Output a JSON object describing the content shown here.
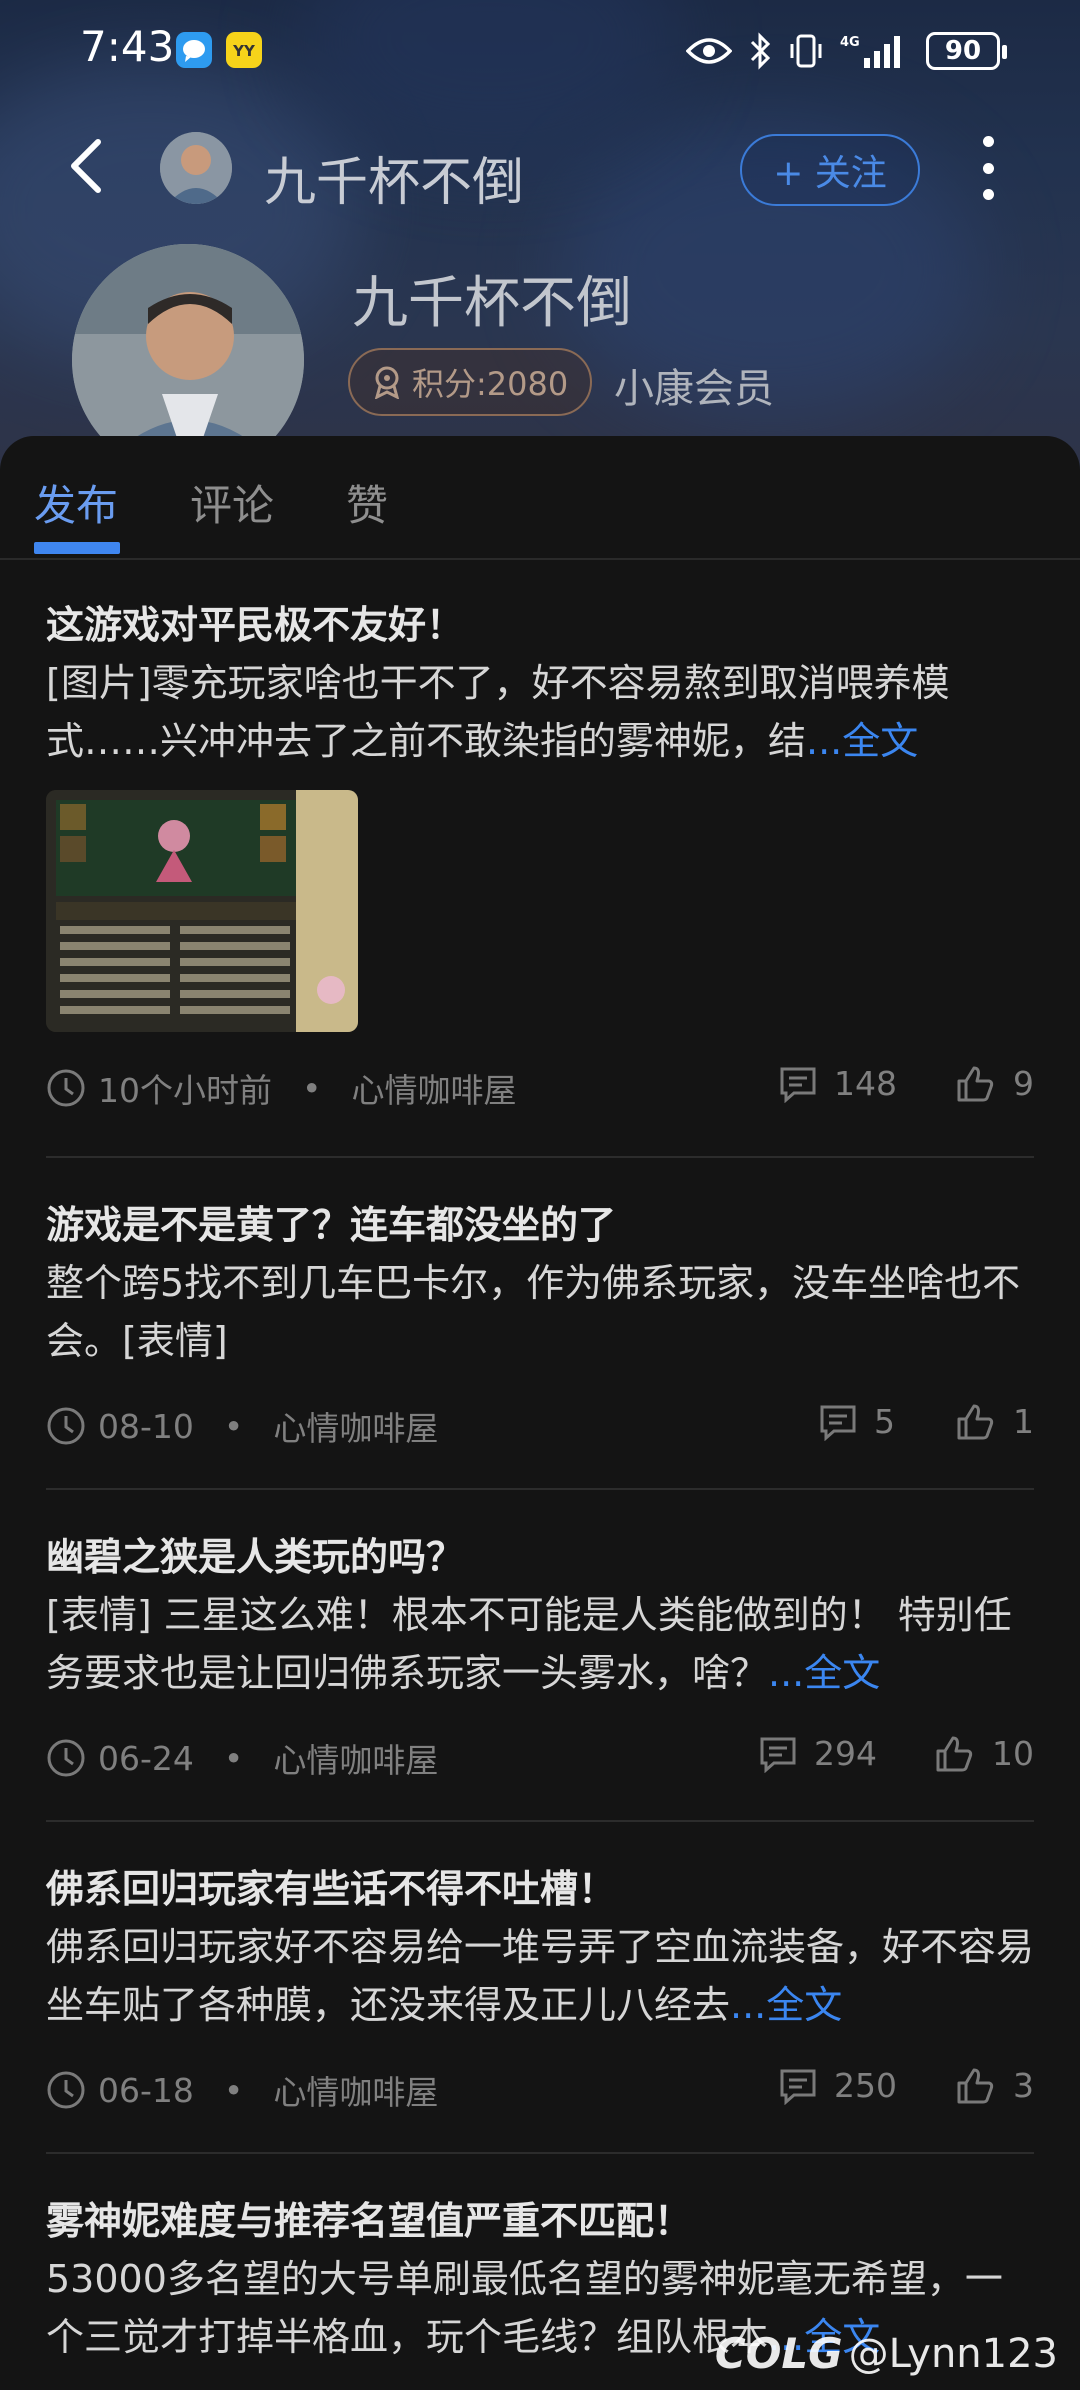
{
  "status_bar": {
    "time": "7:43",
    "network": "4G",
    "battery": "90"
  },
  "header": {
    "username": "九千杯不倒",
    "follow_label": "+ 关注"
  },
  "profile": {
    "name": "九千杯不倒",
    "score": "积分:2080",
    "member_level": "小康会员"
  },
  "tabs": [
    {
      "label": "发布"
    },
    {
      "label": "评论"
    },
    {
      "label": "赞"
    }
  ],
  "posts": [
    {
      "title": "这游戏对平民极不友好！",
      "body": "[图片]零充玩家啥也干不了，好不容易熬到取消喂养模式……兴冲冲去了之前不敢染指的雾神妮，结",
      "more": "...全文",
      "time": "10个小时前",
      "dot": "•",
      "board": "心情咖啡屋",
      "comments": "148",
      "likes": "9"
    },
    {
      "title": "游戏是不是黄了？连车都没坐的了",
      "body": "整个跨5找不到几车巴卡尔，作为佛系玩家，没车坐啥也不会。[表情]",
      "more": "",
      "time": "08-10",
      "dot": "•",
      "board": "心情咖啡屋",
      "comments": "5",
      "likes": "1"
    },
    {
      "title": "幽碧之狭是人类玩的吗？",
      "body": "[表情] 三星这么难！根本不可能是人类能做到的！ 特别任务要求也是让回归佛系玩家一头雾水，啥？",
      "more": "...全文",
      "time": "06-24",
      "dot": "•",
      "board": "心情咖啡屋",
      "comments": "294",
      "likes": "10"
    },
    {
      "title": "佛系回归玩家有些话不得不吐槽！",
      "body": "佛系回归玩家好不容易给一堆号弄了空血流装备，好不容易坐车贴了各种膜，还没来得及正儿八经去",
      "more": "...全文",
      "time": "06-18",
      "dot": "•",
      "board": "心情咖啡屋",
      "comments": "250",
      "likes": "3"
    },
    {
      "title": "雾神妮难度与推荐名望值严重不匹配！",
      "body": "53000多名望的大号单刷最低名望的雾神妮毫无希望，一个三觉才打掉半格血，玩个毛线？组队根本",
      "more": "...全文",
      "time": "",
      "dot": "",
      "board": "",
      "comments": "",
      "likes": ""
    }
  ],
  "watermark": {
    "logo": "COLG",
    "handle": "@Lynn123"
  }
}
